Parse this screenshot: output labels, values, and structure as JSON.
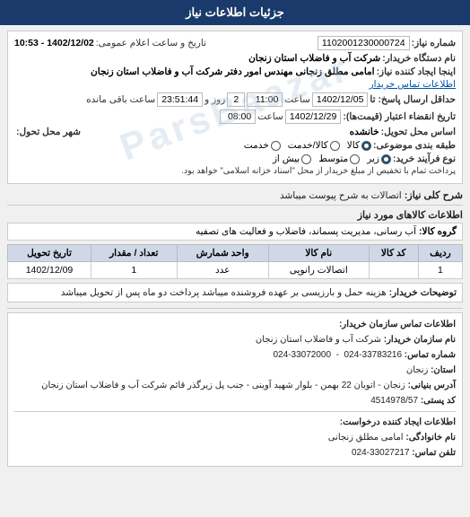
{
  "header": {
    "title": "جزئیات اطلاعات نیاز"
  },
  "topInfo": {
    "niarNumber_label": "شماره نیاز:",
    "niarNumber_value": "1102001230000724",
    "dateTime_label": "تاریخ و ساعت اعلام عمومی:",
    "dateTime_value": "1402/12/02 - 10:53",
    "registrar_label": "نام دستگاه خریدار:",
    "registrar_value": "شرکت آب و فاضلاب استان زنجان",
    "requester_label": "اینجا ایجاد کننده نیاز:",
    "requester_value": "امامی مطلق زنجانی مهندس امور دفتر شرکت آب و فاضلاب استان زنجان",
    "contact_link": "اطلاعات تماس خریدار",
    "deadline_label": "حداقل ارسال پاسخ: تا",
    "deadline_date": "1402/12/05",
    "deadline_time_label": "ساعت",
    "deadline_time": "11:00",
    "deadline_remaining": "2",
    "deadline_remaining_label": "روز و",
    "deadline_remaining_time": "23:51:44",
    "deadline_remaining_suffix": "ساعت باقی مانده",
    "validity_label": "تاریخ انقضاء اعتبار (قیمت‌ها):",
    "validity_date": "1402/12/29",
    "validity_time_label": "ساعت",
    "validity_time": "08:00",
    "delivery_label": "اساس محل تحویل:",
    "delivery_value": "خانشده",
    "city_label": "شهر محل تحول:",
    "city_value": "",
    "category_label": "طبقه بندی موضوعی:",
    "category_options": [
      "کالا",
      "کالا/خدمت",
      "خدمت"
    ],
    "category_selected": "کالا",
    "purchase_type_label": "نوع فرآیند خرید:",
    "purchase_type_options": [
      "زیر",
      "متوسط",
      "بیش از"
    ],
    "purchase_type_selected": "زیر",
    "purchase_type_desc": "پرداخت تمام با تخفیص از مبلغ خریدار از محل \"اسناد خزانه اسلامی\" خواهد بود."
  },
  "sharh": {
    "label": "شرح کلی نیاز:",
    "value": "اتصالات به شرح پیوست میباشد"
  },
  "kalaInfo": {
    "label": "اطلاعات کالاهای مورد نیاز"
  },
  "groupKala": {
    "label": "گروه کالا:",
    "value": "آب رسانی، مدیریت پسماند، فاضلاب و فعالیت های تصفیه"
  },
  "table": {
    "headers": [
      "ردیف",
      "کد کالا",
      "نام کالا",
      "واحد شمارش",
      "تعداد / مقدار",
      "تاریخ تحویل"
    ],
    "rows": [
      {
        "row": "1",
        "code": "",
        "name": "اتصالات رانوپی",
        "unit": "عدد",
        "quantity": "1",
        "date": "1402/12/09"
      }
    ]
  },
  "note": {
    "label": "توضیحات خریدار:",
    "value": "هزینه حمل و بارزیسی بر عهده فروشنده میباشد پرداخت دو ماه پس از تحویل میباشد"
  },
  "contact": {
    "title": "اطلاعات تماس سازمان خریدار:",
    "buyer_name_label": "نام سازمان خریدار:",
    "buyer_name_value": "شرکت آب و فاضلاب استان زنجان",
    "phone1_label": "شماره تماس:",
    "phone1_value": "33783216-024",
    "phone2_value": "33072000-024",
    "province_label": "استان:",
    "province_value": "زنجان",
    "address_label": "آدرس بنیانی:",
    "address_value": "زنجان - اتوبان 22 بهمن - بلوار شهید آوینی - جنب پل زیرگذر قائم شرکت آب و فاضلاب استان زنجان",
    "postal_label": "کد پستی:",
    "postal_value": "4514978/57",
    "requester_org_label": "اطلاعات ایجاد کننده درخواست:",
    "requester_name_label": "نام سازمان:",
    "requester_name_value": "",
    "contact_person_label": "نام خانوادگی:",
    "contact_person_value": "امامی مطلق زنجانی",
    "contact_phone_label": "تلفن تماس:",
    "contact_phone_value": "33027217-024"
  },
  "watermark": "ParsBaazar"
}
